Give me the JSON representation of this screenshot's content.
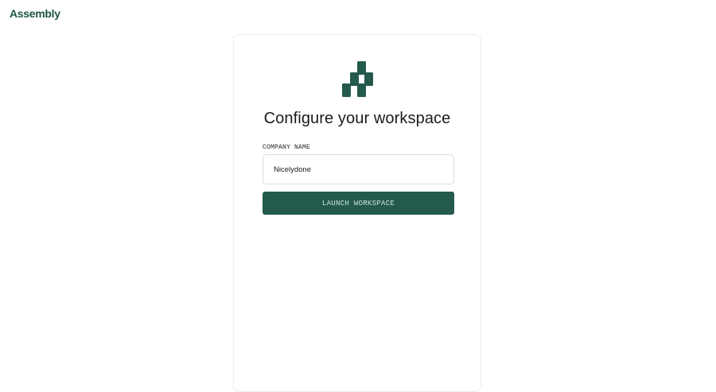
{
  "header": {
    "brand_name": "Assembly"
  },
  "card": {
    "logo_icon": "assembly-logo-icon",
    "title": "Configure your workspace",
    "company_name_label": "COMPANY NAME",
    "company_name_value": "Nicelydone",
    "launch_button_label": "LAUNCH WORKSPACE"
  },
  "colors": {
    "brand_green": "#245a4c",
    "button_text": "#cfe5dc",
    "card_border": "#ececec"
  }
}
